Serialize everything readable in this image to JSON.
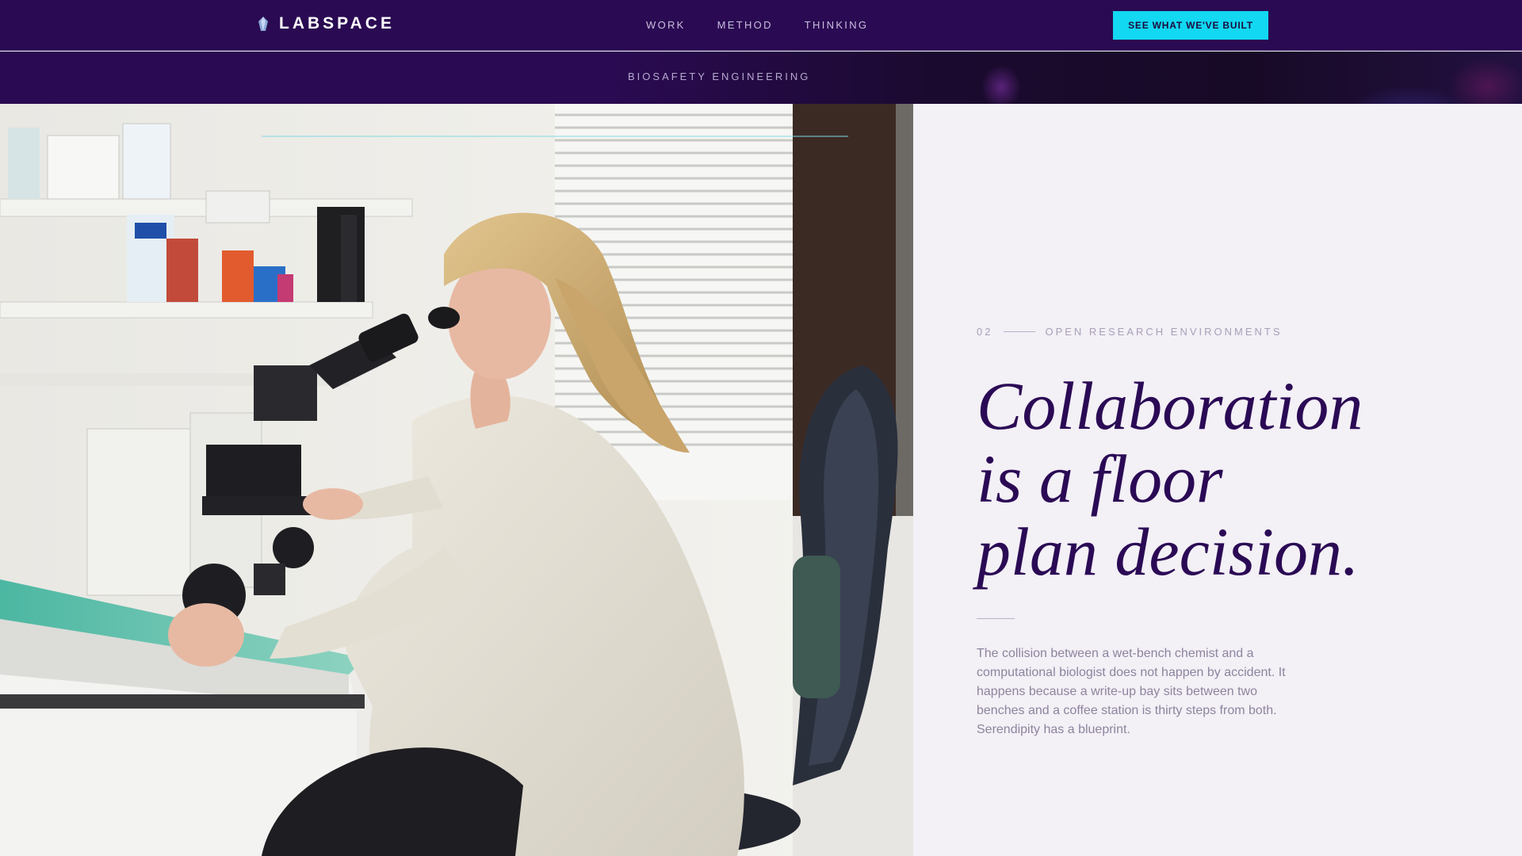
{
  "nav": {
    "brand": "LABSPACE",
    "links": [
      "WORK",
      "METHOD",
      "THINKING"
    ],
    "cta_label": "SEE WHAT WE'VE BUILT"
  },
  "subband": {
    "label": "BIOSAFETY ENGINEERING"
  },
  "feature": {
    "number": "02",
    "eyebrow": "OPEN RESEARCH ENVIRONMENTS",
    "headline_lines": [
      "Collaboration",
      "is a floor",
      "plan decision."
    ],
    "body": "The collision between a wet-bench chemist and a computational biologist does not happen by accident. It happens because a write-up bay sits between two benches and a coffee station is thirty steps from both. Serendipity has a blueprint."
  },
  "colors": {
    "nav_bg": "#2a0a52",
    "accent": "#12d8f2",
    "headline": "#2b0a55",
    "panel_bg": "#f3f0f6"
  },
  "icons": {
    "brand_mark": "crystal-icon"
  }
}
